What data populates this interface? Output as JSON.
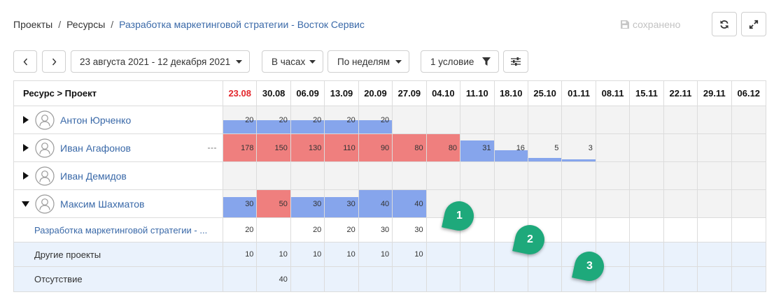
{
  "breadcrumb": {
    "items": [
      {
        "label": "Проекты"
      },
      {
        "label": "Ресурсы"
      },
      {
        "label": "Разработка маркетинговой стратегии - Восток Сервис"
      }
    ],
    "separator": "/"
  },
  "save_status": {
    "icon": "floppy-disk-icon",
    "label": "сохранено"
  },
  "window_actions": {
    "refresh_icon": "refresh-icon",
    "fullscreen_icon": "expand-icon"
  },
  "toolbar": {
    "prev_icon": "chevron-left-icon",
    "next_icon": "chevron-right-icon",
    "date_range": "23 августа 2021 - 12 декабря 2021",
    "units": "В часах",
    "period": "По неделям",
    "filter": "1 условие",
    "filter_icon": "funnel-icon",
    "settings_icon": "sliders-icon",
    "dropdown_icon": "caret-down-icon"
  },
  "table": {
    "first_column_header": "Ресурс > Проект",
    "weeks": [
      {
        "label": "23.08",
        "current": true
      },
      {
        "label": "30.08"
      },
      {
        "label": "06.09"
      },
      {
        "label": "13.09"
      },
      {
        "label": "20.09"
      },
      {
        "label": "27.09"
      },
      {
        "label": "04.10"
      },
      {
        "label": "11.10"
      },
      {
        "label": "18.10"
      },
      {
        "label": "25.10"
      },
      {
        "label": "01.11"
      },
      {
        "label": "08.11"
      },
      {
        "label": "15.11"
      },
      {
        "label": "22.11"
      },
      {
        "label": "29.11"
      },
      {
        "label": "06.12"
      }
    ],
    "resources": [
      {
        "name": "Антон Юрченко",
        "avatar_icon": "user-avatar-icon",
        "expanded": false,
        "hours": [
          20,
          20,
          20,
          20,
          20,
          null,
          null,
          null,
          null,
          null,
          null,
          null,
          null,
          null,
          null,
          null
        ]
      },
      {
        "name": "Иван Агафонов",
        "avatar_icon": "user-avatar-icon",
        "expanded": false,
        "row_menu_icon": "more-horizontal-icon",
        "hours": [
          178,
          150,
          130,
          110,
          90,
          80,
          80,
          31,
          16,
          5,
          3,
          null,
          null,
          null,
          null,
          null
        ]
      },
      {
        "name": "Иван Демидов",
        "avatar_icon": "user-avatar-icon",
        "expanded": false,
        "hours": [
          null,
          null,
          null,
          null,
          null,
          null,
          null,
          null,
          null,
          null,
          null,
          null,
          null,
          null,
          null,
          null
        ]
      },
      {
        "name": "Максим Шахматов",
        "avatar_icon": "user-avatar-icon",
        "expanded": true,
        "hours": [
          30,
          50,
          30,
          30,
          40,
          40,
          null,
          null,
          null,
          null,
          null,
          null,
          null,
          null,
          null,
          null
        ],
        "projects": [
          {
            "name": "Разработка маркетинговой стратегии - ...",
            "is_link": true,
            "shaded": false,
            "hours": [
              20,
              null,
              20,
              20,
              30,
              30,
              null,
              null,
              null,
              null,
              null,
              null,
              null,
              null,
              null,
              null
            ]
          },
          {
            "name": "Другие проекты",
            "is_link": false,
            "shaded": true,
            "hours": [
              10,
              10,
              10,
              10,
              10,
              10,
              null,
              null,
              null,
              null,
              null,
              null,
              null,
              null,
              null,
              null
            ]
          },
          {
            "name": "Отсутствие",
            "is_link": false,
            "shaded": true,
            "hours": [
              null,
              40,
              null,
              null,
              null,
              null,
              null,
              null,
              null,
              null,
              null,
              null,
              null,
              null,
              null,
              null
            ]
          }
        ]
      }
    ]
  },
  "colors": {
    "link": "#3a69a8",
    "current_week": "#e3262c",
    "load_bar": "#86a5ec",
    "overload_bar": "#ef7f7e",
    "empty_week_cell": "#f3f3f3",
    "shaded_row": "#eaf2fc",
    "marker": "#1ea97b",
    "saved_status": "#c2c2c2"
  },
  "markers": [
    "1",
    "2",
    "3"
  ]
}
